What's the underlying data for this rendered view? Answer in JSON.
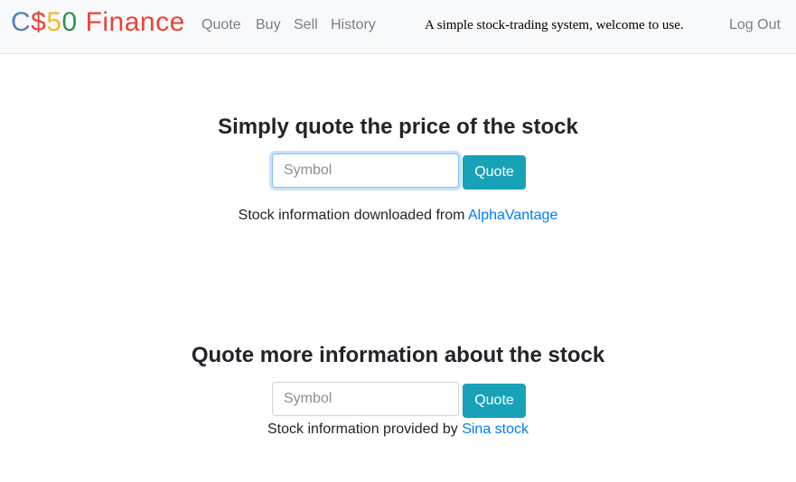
{
  "navbar": {
    "brand": {
      "parts": [
        "C",
        "$",
        "50",
        " Finance"
      ],
      "colors": [
        "#537fbe",
        "#ea433b",
        "#f5b82e",
        "#2e944b",
        "#ea433b"
      ]
    },
    "links": [
      "Quote",
      "Buy",
      "Sell",
      "History"
    ],
    "tagline": "A simple stock-trading system, welcome to use.",
    "logout_label": "Log Out"
  },
  "simple_quote": {
    "heading": "Simply quote the price of the stock",
    "input_placeholder": "Symbol",
    "button_label": "Quote",
    "info_prefix": "Stock information downloaded from ",
    "info_link": "AlphaVantage"
  },
  "more_quote": {
    "heading": "Quote more information about the stock",
    "input_placeholder": "Symbol",
    "button_label": "Quote",
    "info_prefix": "Stock information provided by ",
    "info_link": "Sina stock"
  },
  "colors": {
    "accent_button": "#17a2b8",
    "link": "#007bff",
    "navbar_bg": "#f8f9fa"
  }
}
